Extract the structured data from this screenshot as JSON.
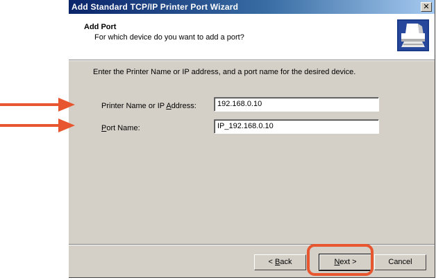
{
  "window": {
    "title": "Add Standard TCP/IP Printer Port Wizard",
    "close_glyph": "✕"
  },
  "header": {
    "title": "Add Port",
    "subtitle": "For which device do you want to add a port?",
    "icon": "printer-icon"
  },
  "instructions": "Enter the Printer Name or IP address, and a port name for the desired device.",
  "fields": {
    "printer_name": {
      "label_pre": "Printer Name or IP ",
      "label_access": "A",
      "label_post": "ddress:",
      "value": "192.168.0.10"
    },
    "port_name": {
      "label_access": "P",
      "label_post": "ort Name:",
      "value": "IP_192.168.0.10"
    }
  },
  "buttons": {
    "back": {
      "pre": "< ",
      "access": "B",
      "post": "ack"
    },
    "next": {
      "access": "N",
      "post": "ext >"
    },
    "cancel": {
      "label": "Cancel"
    }
  },
  "annotations": {
    "arrow_color": "#e8562f",
    "highlight_color": "#e8562f"
  },
  "colors": {
    "dialog_bg": "#d4d0c8",
    "titlebar_start": "#0a246a",
    "titlebar_end": "#a6caf0"
  }
}
